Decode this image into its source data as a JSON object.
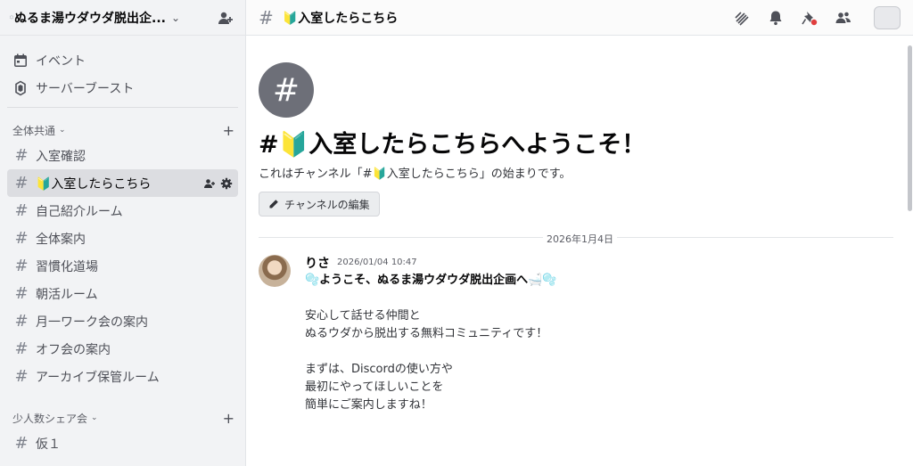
{
  "server": {
    "name_prefix": "꙳",
    "name": "ぬるま湯ウダウダ脱出企...",
    "chevron": "⌄"
  },
  "sidebar": {
    "top_links": [
      {
        "label": "イベント",
        "icon": "calendar-icon"
      },
      {
        "label": "サーバーブースト",
        "icon": "boost-icon"
      }
    ],
    "categories": [
      {
        "label": "全体共通",
        "channels": [
          {
            "label": "入室確認"
          },
          {
            "label": "🔰入室したらこちら",
            "active": true
          },
          {
            "label": "自己紹介ルーム"
          },
          {
            "label": "全体案内"
          },
          {
            "label": "習慣化道場"
          },
          {
            "label": "朝活ルーム"
          },
          {
            "label": "月一ワーク会の案内"
          },
          {
            "label": "オフ会の案内"
          },
          {
            "label": "アーカイブ保管ルーム"
          }
        ]
      },
      {
        "label": "少人数シェア会",
        "channels": [
          {
            "label": "仮１",
            "locked": true
          }
        ]
      }
    ]
  },
  "topbar": {
    "channel_title": "🔰入室したらこちら",
    "icons": [
      "threads-icon",
      "bell-icon",
      "pin-icon",
      "members-icon"
    ]
  },
  "welcome": {
    "title": "#🔰入室したらこちらへようこそ！",
    "subtitle": "これはチャンネル「#🔰入室したらこちら」の始まりです。",
    "edit_button": "チャンネルの編集"
  },
  "divider": {
    "date": "2026年1月4日"
  },
  "message": {
    "author": "りさ",
    "timestamp": "2026/01/04 10:47",
    "headline": "🫧ようこそ、ぬるま湯ウダウダ脱出企画へ🛁🫧",
    "lines": [
      "",
      "安心して話せる仲間と",
      "ぬるウダから脱出する無料コミュニティです！",
      "",
      "まずは、Discordの使い方や",
      "最初にやってほしいことを",
      "簡単にご案内しますね！"
    ]
  },
  "colors": {
    "sidebar_bg": "#f2f3f5",
    "active_channel_bg": "#dcdde1",
    "welcome_icon_bg": "#6d6f78",
    "pin_badge": "#e03e3e"
  }
}
